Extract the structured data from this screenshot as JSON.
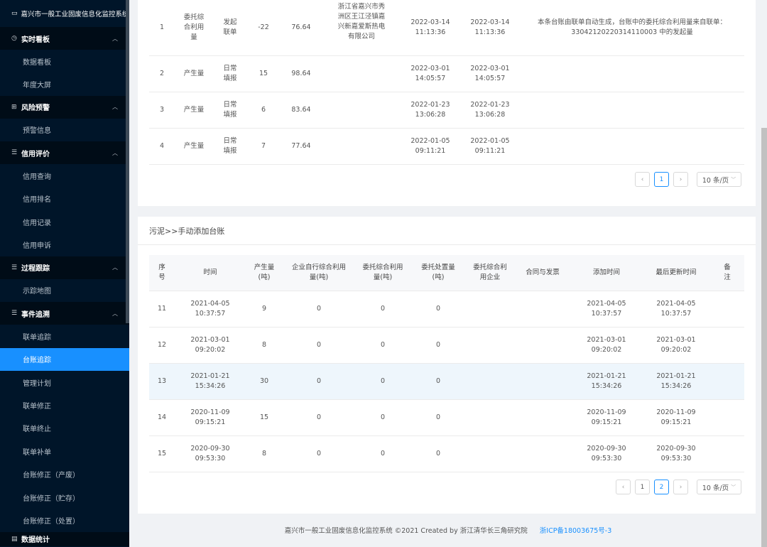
{
  "sidebar": {
    "title": "嘉兴市一般工业固废信息化监控系统",
    "groups": [
      {
        "label": "实时看板",
        "items": [
          "数据看板",
          "年度大屏"
        ]
      },
      {
        "label": "风险预警",
        "items": [
          "预警信息"
        ]
      },
      {
        "label": "信用评价",
        "items": [
          "信用查询",
          "信用排名",
          "信用记录",
          "信用申诉"
        ]
      },
      {
        "label": "过程跟踪",
        "items": [
          "示踪地图"
        ]
      },
      {
        "label": "事件追溯",
        "items": [
          "联单追踪",
          "台账追踪",
          "管理计划",
          "联单修正",
          "联单终止",
          "联单补单",
          "台账修正（产废）",
          "台账修正（贮存）",
          "台账修正（处置）"
        ]
      },
      {
        "label": "数据统计"
      }
    ]
  },
  "table1": {
    "rows": [
      {
        "idx": "1",
        "type": "委托综合利用量",
        "src": "发起联单",
        "qty": "-22",
        "stock": "76.64",
        "company": "浙江省嘉兴市秀洲区王江泾镇嘉兴新嘉爱斯热电有限公司",
        "add_date": "2022-03-14",
        "add_time": "11:13:36",
        "upd_date": "2022-03-14",
        "upd_time": "11:13:36",
        "remark": "本条台账由联单自动生成，台账中的委托综合利用量来自联单：33042120220314110003 中的发起量"
      },
      {
        "idx": "2",
        "type": "产生量",
        "src": "日常填报",
        "qty": "15",
        "stock": "98.64",
        "company": "",
        "add_date": "2022-03-01",
        "add_time": "14:05:57",
        "upd_date": "2022-03-01",
        "upd_time": "14:05:57",
        "remark": ""
      },
      {
        "idx": "3",
        "type": "产生量",
        "src": "日常填报",
        "qty": "6",
        "stock": "83.64",
        "company": "",
        "add_date": "2022-01-23",
        "add_time": "13:06:28",
        "upd_date": "2022-01-23",
        "upd_time": "13:06:28",
        "remark": ""
      },
      {
        "idx": "4",
        "type": "产生量",
        "src": "日常填报",
        "qty": "7",
        "stock": "77.64",
        "company": "",
        "add_date": "2022-01-05",
        "add_time": "09:11:21",
        "upd_date": "2022-01-05",
        "upd_time": "09:11:21",
        "remark": ""
      }
    ],
    "pager": {
      "page": "1",
      "size": "10 条/页"
    }
  },
  "section2": {
    "title": "污泥>>手动添加台账",
    "headers": [
      "序号",
      "时间",
      "产生量(吨)",
      "企业自行综合利用量(吨)",
      "委托综合利用量(吨)",
      "委托处置量(吨)",
      "委托综合利用企业",
      "合同与发票",
      "添加时间",
      "最后更新时间",
      "备注"
    ],
    "rows": [
      {
        "idx": "11",
        "d": "2021-04-05",
        "t": "10:37:57",
        "prod": "9",
        "self": "0",
        "util": "0",
        "disp": "0",
        "ad": "2021-04-05",
        "at": "10:37:57",
        "ud": "2021-04-05",
        "ut": "10:37:57"
      },
      {
        "idx": "12",
        "d": "2021-03-01",
        "t": "09:20:02",
        "prod": "8",
        "self": "0",
        "util": "0",
        "disp": "0",
        "ad": "2021-03-01",
        "at": "09:20:02",
        "ud": "2021-03-01",
        "ut": "09:20:02"
      },
      {
        "idx": "13",
        "d": "2021-01-21",
        "t": "15:34:26",
        "prod": "30",
        "self": "0",
        "util": "0",
        "disp": "0",
        "ad": "2021-01-21",
        "at": "15:34:26",
        "ud": "2021-01-21",
        "ut": "15:34:26"
      },
      {
        "idx": "14",
        "d": "2020-11-09",
        "t": "09:15:21",
        "prod": "15",
        "self": "0",
        "util": "0",
        "disp": "0",
        "ad": "2020-11-09",
        "at": "09:15:21",
        "ud": "2020-11-09",
        "ut": "09:15:21"
      },
      {
        "idx": "15",
        "d": "2020-09-30",
        "t": "09:53:30",
        "prod": "8",
        "self": "0",
        "util": "0",
        "disp": "0",
        "ad": "2020-09-30",
        "at": "09:53:30",
        "ud": "2020-09-30",
        "ut": "09:53:30"
      }
    ],
    "pager": {
      "page1": "1",
      "page2": "2",
      "size": "10 条/页"
    }
  },
  "footer": {
    "text": "嘉兴市一般工业固废信息化监控系统 ©2021 Created by 浙江清华长三角研究院",
    "icp": "浙ICP备18003675号-3"
  },
  "colors": {
    "sidebar_bg": "#001529",
    "accent": "#1890ff",
    "highlight_row": "#eef6fc"
  }
}
